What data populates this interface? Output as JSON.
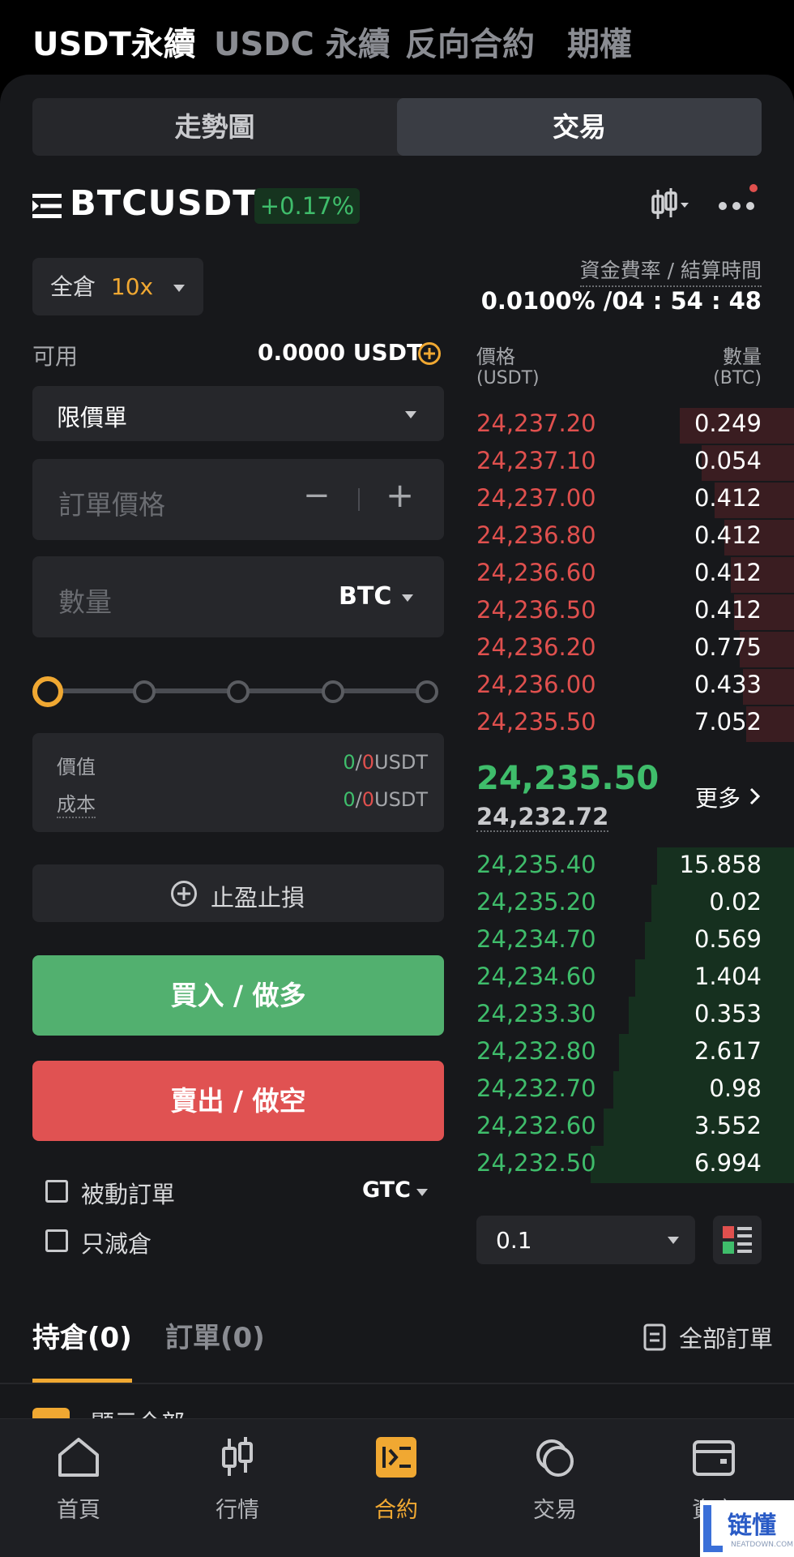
{
  "top_tabs": [
    "USDT永續",
    "USDC 永續",
    "反向合約",
    "期權"
  ],
  "segment": {
    "chart": "走勢圖",
    "trade": "交易"
  },
  "symbol": {
    "name": "BTCUSDT",
    "change": "+0.17%"
  },
  "leverage": {
    "margin_mode": "全倉",
    "multiplier": "10x"
  },
  "funding": {
    "label": "資金費率 / 結算時間",
    "value": "0.0100% /04 : 54 : 48"
  },
  "available": {
    "label": "可用",
    "value": "0.0000 USDT"
  },
  "order_type": "限價單",
  "price_field": {
    "placeholder": "訂單價格",
    "minus": "−",
    "plus": "+"
  },
  "qty_field": {
    "placeholder": "數量",
    "unit": "BTC"
  },
  "slider": {
    "value_pct": 0,
    "steps": 5
  },
  "summary": {
    "value_label": "價值",
    "cost_label": "成本",
    "value_long": "0",
    "value_short": "0",
    "cost_long": "0",
    "cost_short": "0",
    "slash": "/",
    "unit": "USDT"
  },
  "tpsl": "止盈止損",
  "buy_label": "買入 / 做多",
  "sell_label": "賣出 / 做空",
  "options": {
    "post_only": "被動訂單",
    "reduce_only": "只減倉",
    "tif": "GTC"
  },
  "orderbook": {
    "price_header": "價格",
    "price_unit": "(USDT)",
    "qty_header": "數量",
    "qty_unit": "(BTC)",
    "asks": [
      {
        "price": "24,237.20",
        "qty": "0.249",
        "depth": 0.36
      },
      {
        "price": "24,237.10",
        "qty": "0.054",
        "depth": 0.29
      },
      {
        "price": "24,237.00",
        "qty": "0.412",
        "depth": 0.25
      },
      {
        "price": "24,236.80",
        "qty": "0.412",
        "depth": 0.22
      },
      {
        "price": "24,236.60",
        "qty": "0.412",
        "depth": 0.2
      },
      {
        "price": "24,236.50",
        "qty": "0.412",
        "depth": 0.19
      },
      {
        "price": "24,236.20",
        "qty": "0.775",
        "depth": 0.17
      },
      {
        "price": "24,236.00",
        "qty": "0.433",
        "depth": 0.16
      },
      {
        "price": "24,235.50",
        "qty": "7.052",
        "depth": 0.15
      }
    ],
    "last_price": "24,235.50",
    "mark_price": "24,232.72",
    "more": "更多",
    "bids": [
      {
        "price": "24,235.40",
        "qty": "15.858",
        "depth": 0.43
      },
      {
        "price": "24,235.20",
        "qty": "0.02",
        "depth": 0.45
      },
      {
        "price": "24,234.70",
        "qty": "0.569",
        "depth": 0.47
      },
      {
        "price": "24,234.60",
        "qty": "1.404",
        "depth": 0.5
      },
      {
        "price": "24,233.30",
        "qty": "0.353",
        "depth": 0.52
      },
      {
        "price": "24,232.80",
        "qty": "2.617",
        "depth": 0.55
      },
      {
        "price": "24,232.70",
        "qty": "0.98",
        "depth": 0.57
      },
      {
        "price": "24,232.60",
        "qty": "3.552",
        "depth": 0.6
      },
      {
        "price": "24,232.50",
        "qty": "6.994",
        "depth": 0.64
      }
    ],
    "precision": "0.1"
  },
  "positions": {
    "tab_positions": "持倉(0)",
    "tab_orders": "訂單(0)",
    "all_orders": "全部訂單",
    "show_all": "顯示全部"
  },
  "bottom_nav": [
    "首頁",
    "行情",
    "合約",
    "交易",
    "資產"
  ],
  "watermark": {
    "brand": "链懂",
    "site": "NEATDOWN.COM"
  },
  "colors": {
    "green": "#3fbd6b",
    "red": "#e0504e",
    "accent": "#f0a832",
    "buy_bg": "#52b06f",
    "sell_bg": "#e05252"
  }
}
